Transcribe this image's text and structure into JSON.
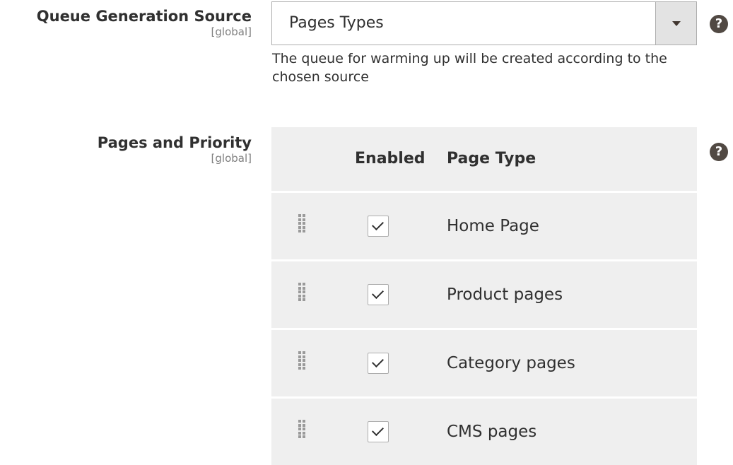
{
  "queue_source": {
    "label": "Queue Generation Source",
    "scope": "[global]",
    "selected": "Pages Types",
    "note": "The queue for warming up will be created according to the chosen source"
  },
  "pages_priority": {
    "label": "Pages and Priority",
    "scope": "[global]",
    "columns": [
      "Enabled",
      "Page Type"
    ],
    "rows": [
      {
        "enabled": true,
        "page_type": "Home Page"
      },
      {
        "enabled": true,
        "page_type": "Product pages"
      },
      {
        "enabled": true,
        "page_type": "Category pages"
      },
      {
        "enabled": true,
        "page_type": "CMS pages"
      }
    ]
  },
  "help_icon_glyph": "?",
  "icons": [
    "help-icon",
    "drag-handle-icon",
    "chevron-down-icon",
    "checkmark-icon"
  ]
}
